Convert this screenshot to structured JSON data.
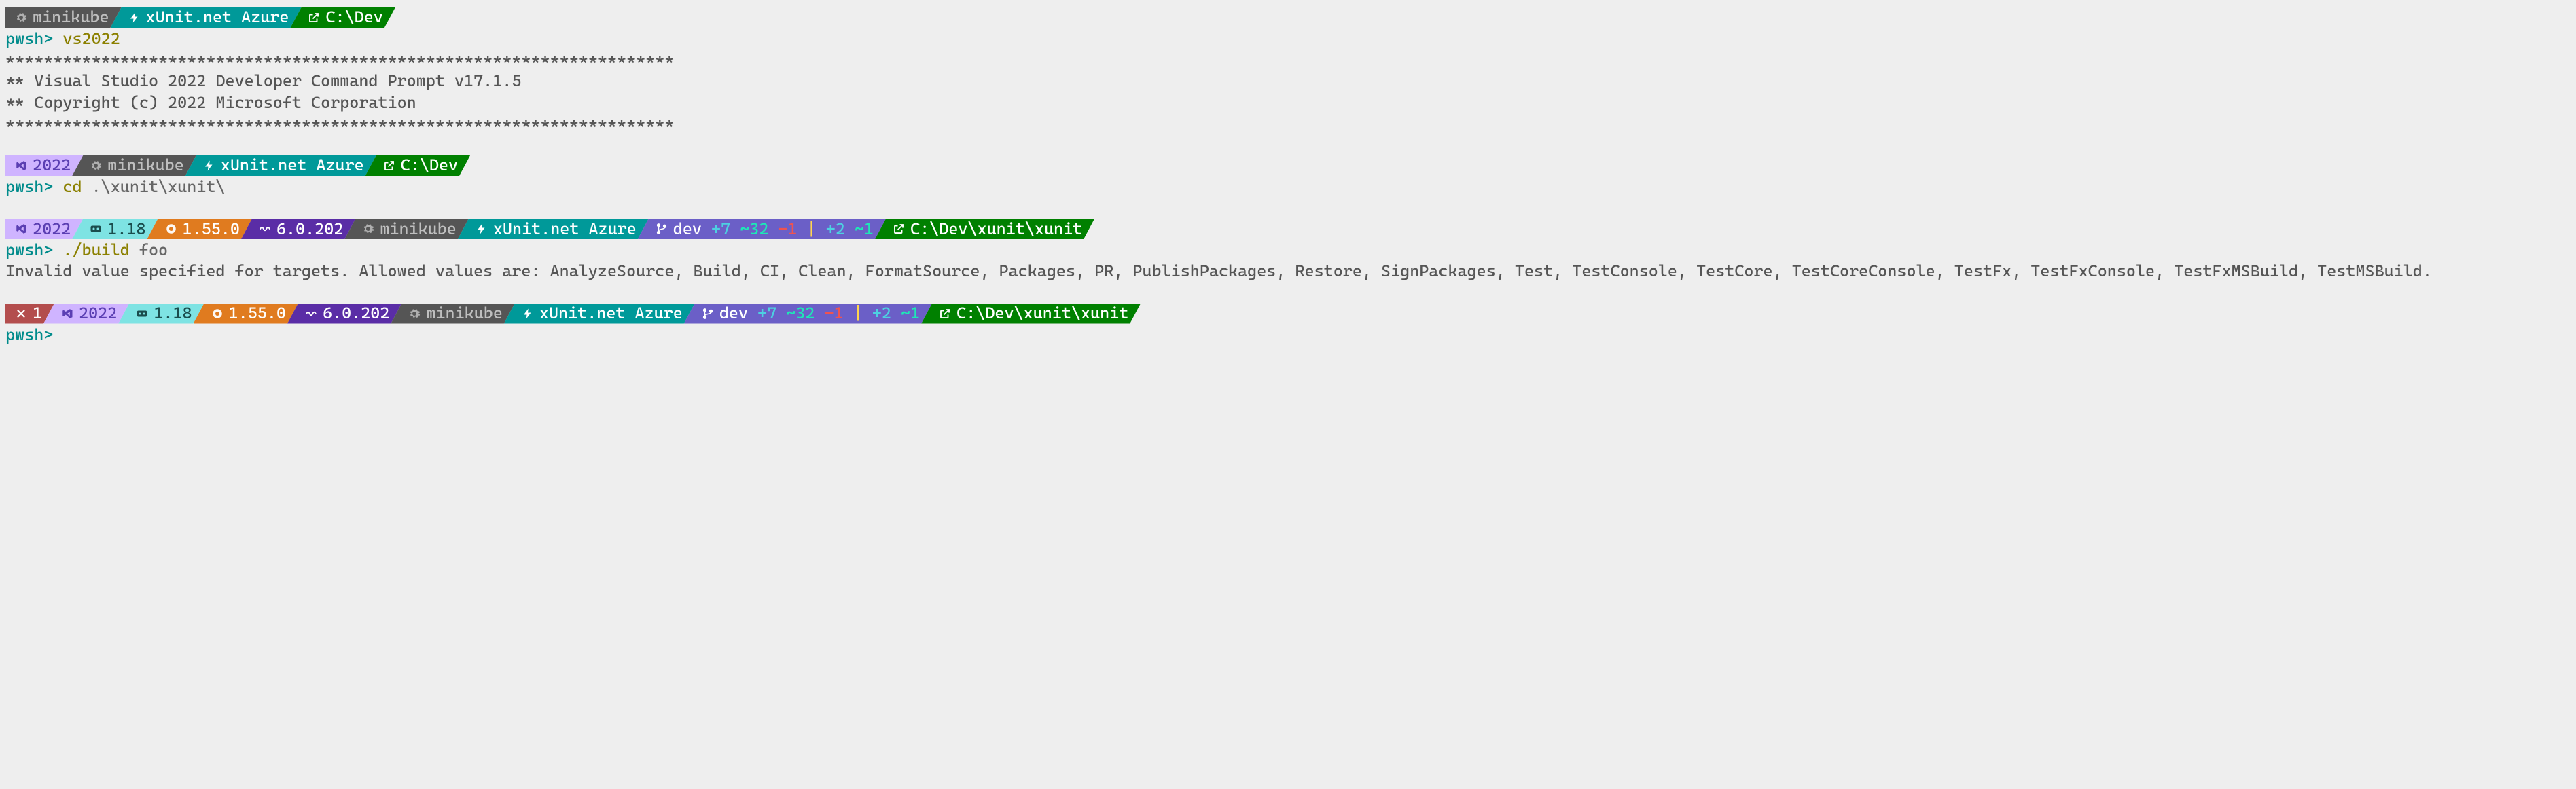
{
  "colors": {
    "gray": {
      "bg": "#555555",
      "fg": "#bfbfbf"
    },
    "teal": {
      "bg": "#009999",
      "fg": "#ffffff"
    },
    "green": {
      "bg": "#008000",
      "fg": "#ffffff"
    },
    "lav": {
      "bg": "#cfb4ff",
      "fg": "#5b3fb3"
    },
    "cyan": {
      "bg": "#7ee3e3",
      "fg": "#1a4d4d"
    },
    "orange": {
      "bg": "#e07b1f",
      "fg": "#ffffff"
    },
    "purple": {
      "bg": "#5a2da6",
      "fg": "#ffffff"
    },
    "indigo": {
      "bg": "#6b5fc7",
      "fg": "#ffffff"
    },
    "red": {
      "bg": "#b34d4d",
      "fg": "#ffffff"
    }
  },
  "prompt": "pwsh>",
  "rows": [
    {
      "segments": [
        {
          "icon": "gear",
          "text": "minikube",
          "color": "gray"
        },
        {
          "icon": "bolt",
          "text": "xUnit.net Azure",
          "color": "teal"
        },
        {
          "icon": "link",
          "text": "C:\\Dev",
          "color": "green"
        }
      ],
      "cmd": {
        "prompt": true,
        "command": "vs2022",
        "arg": ""
      }
    },
    {
      "output": "**********************************************************************"
    },
    {
      "output": "** Visual Studio 2022 Developer Command Prompt v17.1.5"
    },
    {
      "output": "** Copyright (c) 2022 Microsoft Corporation"
    },
    {
      "output": "**********************************************************************"
    },
    {
      "spacer": true
    },
    {
      "segments": [
        {
          "icon": "vs",
          "text": "2022",
          "color": "lav"
        },
        {
          "icon": "gear",
          "text": "minikube",
          "color": "gray"
        },
        {
          "icon": "bolt",
          "text": "xUnit.net Azure",
          "color": "teal"
        },
        {
          "icon": "link",
          "text": "C:\\Dev",
          "color": "green"
        }
      ],
      "cmd": {
        "prompt": true,
        "command": "cd",
        "arg": ".\\xunit\\xunit\\"
      }
    },
    {
      "spacer": true
    },
    {
      "segments": [
        {
          "icon": "vs",
          "text": "2022",
          "color": "lav"
        },
        {
          "icon": "go",
          "text": "1.18",
          "color": "cyan"
        },
        {
          "icon": "rust",
          "text": "1.55.0",
          "color": "orange"
        },
        {
          "icon": "wave",
          "text": "6.0.202",
          "color": "purple"
        },
        {
          "icon": "gear",
          "text": "minikube",
          "color": "gray"
        },
        {
          "icon": "bolt",
          "text": "xUnit.net Azure",
          "color": "teal"
        },
        {
          "icon": "branch",
          "git": {
            "branch": "dev",
            "ahead": "+7",
            "mod": "~32",
            "del": "-1",
            "sep": "|",
            "s1": "+2",
            "s2": "~1"
          },
          "color": "indigo"
        },
        {
          "icon": "link",
          "text": "C:\\Dev\\xunit\\xunit",
          "color": "green"
        }
      ],
      "cmd": {
        "prompt": true,
        "command": "./build",
        "arg": "foo"
      }
    },
    {
      "output": "Invalid value specified for targets. Allowed values are: AnalyzeSource, Build, CI, Clean, FormatSource, Packages, PR, PublishPackages, Restore, SignPackages, Test, TestConsole, TestCore, TestCoreConsole, TestFx, TestFxConsole, TestFxMSBuild, TestMSBuild.",
      "wrap": true
    },
    {
      "spacer": true
    },
    {
      "segments": [
        {
          "icon": "x",
          "text": "1",
          "color": "red"
        },
        {
          "icon": "vs",
          "text": "2022",
          "color": "lav"
        },
        {
          "icon": "go",
          "text": "1.18",
          "color": "cyan"
        },
        {
          "icon": "rust",
          "text": "1.55.0",
          "color": "orange"
        },
        {
          "icon": "wave",
          "text": "6.0.202",
          "color": "purple"
        },
        {
          "icon": "gear",
          "text": "minikube",
          "color": "gray"
        },
        {
          "icon": "bolt",
          "text": "xUnit.net Azure",
          "color": "teal"
        },
        {
          "icon": "branch",
          "git": {
            "branch": "dev",
            "ahead": "+7",
            "mod": "~32",
            "del": "-1",
            "sep": "|",
            "s1": "+2",
            "s2": "~1"
          },
          "color": "indigo"
        },
        {
          "icon": "link",
          "text": "C:\\Dev\\xunit\\xunit",
          "color": "green"
        }
      ],
      "cmd": {
        "prompt": true,
        "command": "",
        "arg": ""
      }
    }
  ]
}
